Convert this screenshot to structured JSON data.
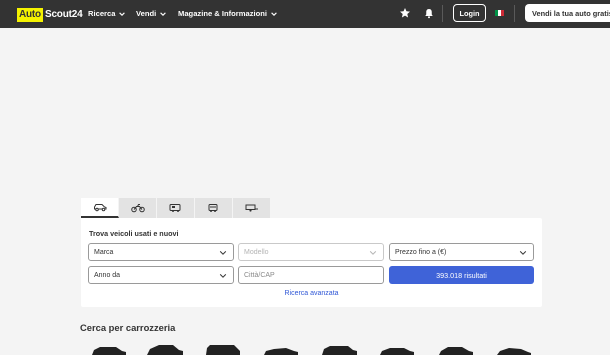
{
  "header": {
    "logo_auto": "Auto",
    "logo_scout": "Scout24",
    "nav": [
      {
        "label": "Ricerca"
      },
      {
        "label": "Vendi"
      },
      {
        "label": "Magazine & Informazioni"
      }
    ],
    "login_label": "Login",
    "sell_label": "Vendi la tua auto gratis",
    "flag_colors": [
      "#009246",
      "#ffffff",
      "#ce2b37"
    ]
  },
  "search": {
    "tabs": [
      {
        "icon": "car-icon"
      },
      {
        "icon": "motorcycle-icon"
      },
      {
        "icon": "camper-icon"
      },
      {
        "icon": "truck-icon"
      },
      {
        "icon": "trailer-icon"
      }
    ],
    "title": "Trova veicoli usati e nuovi",
    "make": "Marca",
    "model": "Modello",
    "price": "Prezzo fino a (€)",
    "year": "Anno da",
    "city_placeholder": "Città/CAP",
    "results_button": "393.018 risultati",
    "advanced_link": "Ricerca avanzata"
  },
  "body_types": {
    "title": "Cerca per carrozzeria"
  },
  "colors": {
    "header_bg": "#333333",
    "brand_yellow": "#f5f200",
    "accent_blue": "#3f63d8",
    "link_blue": "#2f57d6"
  }
}
